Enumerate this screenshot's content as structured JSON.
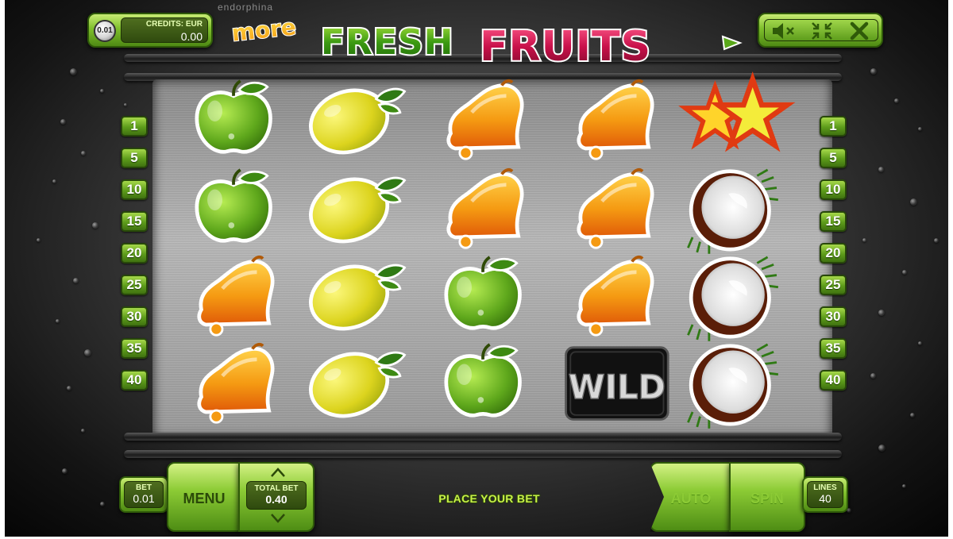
{
  "header": {
    "denomination": "0.01",
    "credits_label": "CREDITS: EUR",
    "credits_value": "0.00",
    "brand": "endorphina",
    "logo_word_1": "more",
    "logo_word_2": "FRESH",
    "logo_word_3": "FRUITS"
  },
  "window_controls": {
    "sound_icon": "speaker-mute-icon",
    "minimize_icon": "collapse-icon",
    "close_icon": "close-icon"
  },
  "paylines_left": [
    "1",
    "5",
    "10",
    "15",
    "20",
    "25",
    "30",
    "35",
    "40"
  ],
  "paylines_right": [
    "1",
    "5",
    "10",
    "15",
    "20",
    "25",
    "30",
    "35",
    "40"
  ],
  "reels": [
    [
      "apple",
      "apple",
      "bell",
      "bell"
    ],
    [
      "lemon",
      "lemon",
      "lemon",
      "lemon"
    ],
    [
      "bell",
      "bell",
      "apple",
      "apple"
    ],
    [
      "bell",
      "bell",
      "bell",
      "wild"
    ],
    [
      "star",
      "coconut",
      "coconut",
      "coconut"
    ]
  ],
  "wild_label": "WILD",
  "controls": {
    "bet_label": "BET",
    "bet_value": "0.01",
    "menu_label": "MENU",
    "total_bet_label": "TOTAL BET",
    "total_bet_value": "0.40",
    "status": "PLACE YOUR BET",
    "auto_label": "AUTO",
    "spin_label": "SPIN",
    "lines_label": "LINES",
    "lines_value": "40"
  },
  "colors": {
    "accent_green": "#7fbf2c",
    "apple_green": "#5fa81c",
    "lemon_yellow": "#e6e02a",
    "bell_orange": "#f59a12",
    "star_red": "#e03a12"
  }
}
